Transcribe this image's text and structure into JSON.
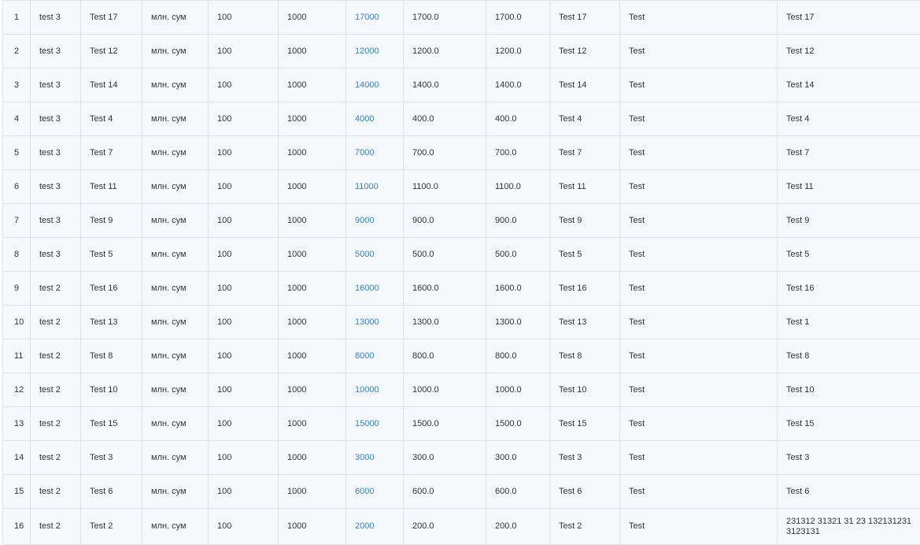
{
  "colors": {
    "link": "#3a7ec8",
    "cell_background": "#f6f9fc",
    "border": "#dde3ea",
    "text": "#333333"
  },
  "rows": [
    {
      "no": "1",
      "group": "test 3",
      "name": "Test 17",
      "unit": "млн. сум",
      "qty": "100",
      "price": "1000",
      "total": "17000",
      "v1": "1700.0",
      "v2": "1700.0",
      "name2": "Test 17",
      "note": "Test",
      "comment": "Test 17"
    },
    {
      "no": "2",
      "group": "test 3",
      "name": "Test 12",
      "unit": "млн. сум",
      "qty": "100",
      "price": "1000",
      "total": "12000",
      "v1": "1200.0",
      "v2": "1200.0",
      "name2": "Test 12",
      "note": "Test",
      "comment": "Test 12"
    },
    {
      "no": "3",
      "group": "test 3",
      "name": "Test 14",
      "unit": "млн. сум",
      "qty": "100",
      "price": "1000",
      "total": "14000",
      "v1": "1400.0",
      "v2": "1400.0",
      "name2": "Test 14",
      "note": "Test",
      "comment": "Test 14"
    },
    {
      "no": "4",
      "group": "test 3",
      "name": "Test 4",
      "unit": "млн. сум",
      "qty": "100",
      "price": "1000",
      "total": "4000",
      "v1": "400.0",
      "v2": "400.0",
      "name2": "Test 4",
      "note": "Test",
      "comment": "Test 4"
    },
    {
      "no": "5",
      "group": "test 3",
      "name": "Test 7",
      "unit": "млн. сум",
      "qty": "100",
      "price": "1000",
      "total": "7000",
      "v1": "700.0",
      "v2": "700.0",
      "name2": "Test 7",
      "note": "Test",
      "comment": "Test 7"
    },
    {
      "no": "6",
      "group": "test 3",
      "name": "Test 11",
      "unit": "млн. сум",
      "qty": "100",
      "price": "1000",
      "total": "11000",
      "v1": "1100.0",
      "v2": "1100.0",
      "name2": "Test 11",
      "note": "Test",
      "comment": "Test 11"
    },
    {
      "no": "7",
      "group": "test 3",
      "name": "Test 9",
      "unit": "млн. сум",
      "qty": "100",
      "price": "1000",
      "total": "9000",
      "v1": "900.0",
      "v2": "900.0",
      "name2": "Test 9",
      "note": "Test",
      "comment": "Test 9"
    },
    {
      "no": "8",
      "group": "test 3",
      "name": "Test 5",
      "unit": "млн. сум",
      "qty": "100",
      "price": "1000",
      "total": "5000",
      "v1": "500.0",
      "v2": "500.0",
      "name2": "Test 5",
      "note": "Test",
      "comment": "Test 5"
    },
    {
      "no": "9",
      "group": "test 2",
      "name": "Test 16",
      "unit": "млн. сум",
      "qty": "100",
      "price": "1000",
      "total": "16000",
      "v1": "1600.0",
      "v2": "1600.0",
      "name2": "Test 16",
      "note": "Test",
      "comment": "Test 16"
    },
    {
      "no": "10",
      "group": "test 2",
      "name": "Test 13",
      "unit": "млн. сум",
      "qty": "100",
      "price": "1000",
      "total": "13000",
      "v1": "1300.0",
      "v2": "1300.0",
      "name2": "Test 13",
      "note": "Test",
      "comment": "Test 1"
    },
    {
      "no": "11",
      "group": "test 2",
      "name": "Test 8",
      "unit": "млн. сум",
      "qty": "100",
      "price": "1000",
      "total": "8000",
      "v1": "800.0",
      "v2": "800.0",
      "name2": "Test 8",
      "note": "Test",
      "comment": "Test 8"
    },
    {
      "no": "12",
      "group": "test 2",
      "name": "Test 10",
      "unit": "млн. сум",
      "qty": "100",
      "price": "1000",
      "total": "10000",
      "v1": "1000.0",
      "v2": "1000.0",
      "name2": "Test 10",
      "note": "Test",
      "comment": "Test 10"
    },
    {
      "no": "13",
      "group": "test 2",
      "name": "Test 15",
      "unit": "млн. сум",
      "qty": "100",
      "price": "1000",
      "total": "15000",
      "v1": "1500.0",
      "v2": "1500.0",
      "name2": "Test 15",
      "note": "Test",
      "comment": "Test 15"
    },
    {
      "no": "14",
      "group": "test 2",
      "name": "Test 3",
      "unit": "млн. сум",
      "qty": "100",
      "price": "1000",
      "total": "3000",
      "v1": "300.0",
      "v2": "300.0",
      "name2": "Test 3",
      "note": "Test",
      "comment": "Test 3"
    },
    {
      "no": "15",
      "group": "test 2",
      "name": "Test 6",
      "unit": "млн. сум",
      "qty": "100",
      "price": "1000",
      "total": "6000",
      "v1": "600.0",
      "v2": "600.0",
      "name2": "Test 6",
      "note": "Test",
      "comment": "Test 6"
    },
    {
      "no": "16",
      "group": "test 2",
      "name": "Test 2",
      "unit": "млн. сум",
      "qty": "100",
      "price": "1000",
      "total": "2000",
      "v1": "200.0",
      "v2": "200.0",
      "name2": "Test 2",
      "note": "Test",
      "comment": "231312 31321 31 23 1321312313123131"
    }
  ]
}
